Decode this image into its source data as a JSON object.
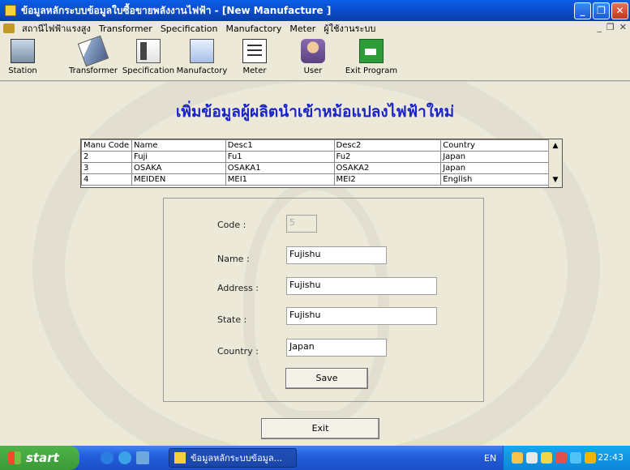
{
  "window": {
    "title": "ข้อมูลหลักระบบข้อมูลใบซื้อขายพลังงานไฟฟ้า - [New Manufacture ]",
    "controls": [
      "_",
      "❐",
      "✕"
    ]
  },
  "menu": {
    "items": [
      "สถานีไฟฟ้าแรงสูง",
      "Transformer",
      "Specification",
      "Manufactory",
      "Meter",
      "ผู้ใช้งานระบบ"
    ],
    "mdi_controls": [
      "_",
      "❐",
      "✕"
    ]
  },
  "toolbar": {
    "buttons": [
      {
        "label": "Station",
        "icon": "station-icon"
      },
      {
        "label": "Transformer",
        "icon": "transformer-icon"
      },
      {
        "label": "Specification",
        "icon": "specification-icon"
      },
      {
        "label": "Manufactory",
        "icon": "manufactory-icon"
      },
      {
        "label": "Meter",
        "icon": "meter-icon"
      },
      {
        "label": "User",
        "icon": "user-icon"
      },
      {
        "label": "Exit Program",
        "icon": "exit-program-icon"
      }
    ]
  },
  "page": {
    "title": "เพิ่มข้อมูลผู้ผลิตนำเข้าหม้อแปลงไฟฟ้าใหม่"
  },
  "grid": {
    "columns": [
      "Manu Code",
      "Name",
      "Desc1",
      "Desc2",
      "Country"
    ],
    "rows": [
      [
        "2",
        "Fuji",
        "Fu1",
        "Fu2",
        "Japan"
      ],
      [
        "3",
        "OSAKA",
        "OSAKA1",
        "OSAKA2",
        "Japan"
      ],
      [
        "4",
        "MEIDEN",
        "MEI1",
        "MEI2",
        "English"
      ]
    ]
  },
  "form": {
    "code": {
      "label": "Code :",
      "value": "5"
    },
    "name": {
      "label": "Name :",
      "value": "Fujishu"
    },
    "address": {
      "label": "Address :",
      "value": "Fujishu"
    },
    "state": {
      "label": "State :",
      "value": "Fujishu"
    },
    "country": {
      "label": "Country :",
      "value": "Japan"
    },
    "save_label": "Save"
  },
  "exit_label": "Exit",
  "taskbar": {
    "start_label": "start",
    "task_label": "ข้อมูลหลักระบบข้อมูล...",
    "language": "EN",
    "clock": "22:43"
  }
}
